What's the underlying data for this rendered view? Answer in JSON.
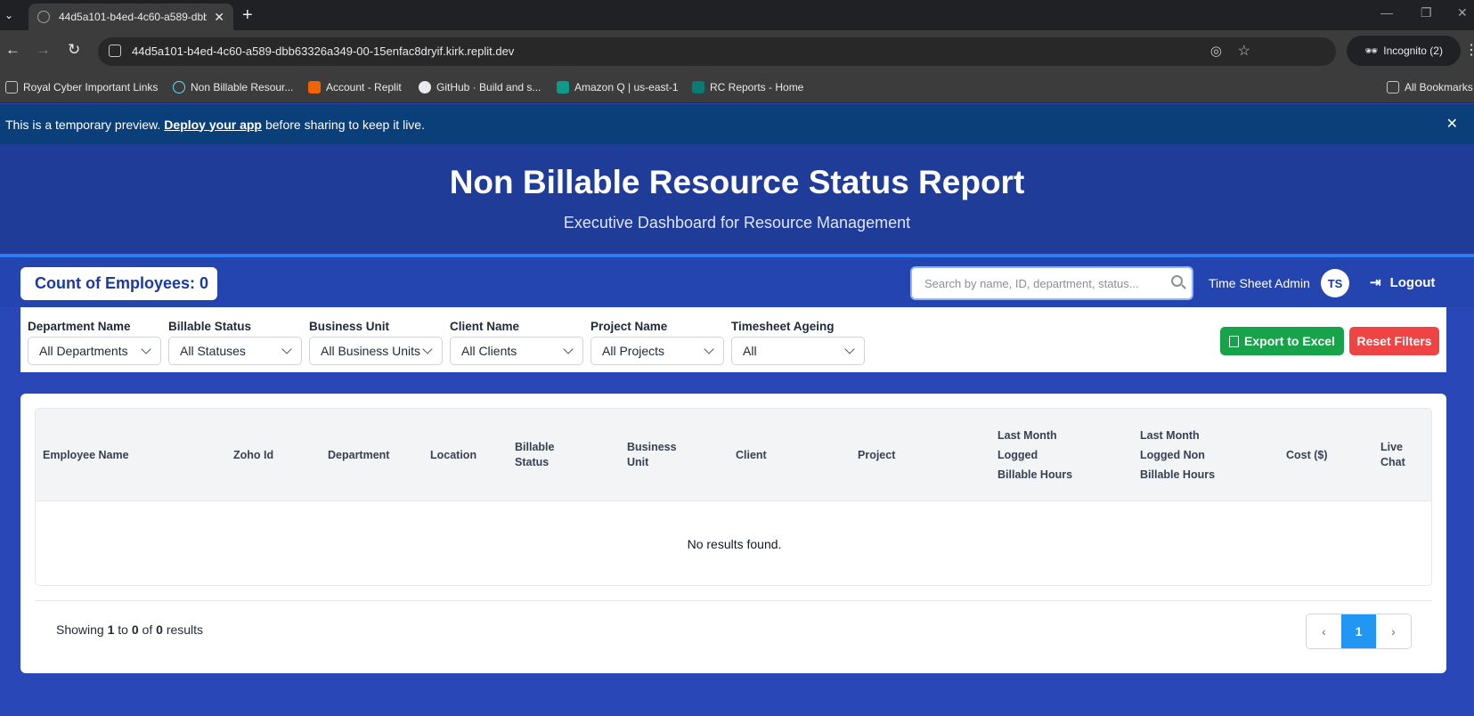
{
  "browser": {
    "tab_title": "44d5a101-b4ed-4c60-a589-dbb",
    "url": "44d5a101-b4ed-4c60-a589-dbb63326a349-00-15enfac8dryif.kirk.replit.dev",
    "incognito_label": "Incognito (2)",
    "bookmarks": [
      "Royal Cyber Important Links",
      "Non Billable Resour...",
      "Account - Replit",
      "GitHub · Build and s...",
      "Amazon Q | us-east-1",
      "RC Reports - Home"
    ],
    "all_bookmarks_label": "All Bookmarks"
  },
  "preview_banner": {
    "text_before": "This is a temporary preview.",
    "link_text": "Deploy your app",
    "text_after": "before sharing to keep it live."
  },
  "header": {
    "title": "Non Billable Resource Status Report",
    "subtitle": "Executive Dashboard for Resource Management"
  },
  "toolbar": {
    "count_label": "Count of Employees: 0",
    "search_placeholder": "Search by name, ID, department, status...",
    "user_name": "Time Sheet Admin",
    "avatar_initials": "TS",
    "logout_label": "Logout"
  },
  "filters": [
    {
      "label": "Department Name",
      "value": "All Departments"
    },
    {
      "label": "Billable Status",
      "value": "All Statuses"
    },
    {
      "label": "Business Unit",
      "value": "All Business Units"
    },
    {
      "label": "Client Name",
      "value": "All Clients"
    },
    {
      "label": "Project Name",
      "value": "All Projects"
    },
    {
      "label": "Timesheet Ageing",
      "value": "All"
    }
  ],
  "actions": {
    "export_label": "Export to Excel",
    "reset_label": "Reset Filters"
  },
  "table": {
    "columns": [
      [
        "Employee Name"
      ],
      [
        "Zoho Id"
      ],
      [
        "Department"
      ],
      [
        "Location"
      ],
      [
        "Billable",
        "Status"
      ],
      [
        "Business",
        "Unit"
      ],
      [
        "Client"
      ],
      [
        "Project"
      ],
      [
        "Last Month",
        "Logged",
        "Billable Hours"
      ],
      [
        "Last Month",
        "Logged Non",
        "Billable Hours"
      ],
      [
        "Cost ($)"
      ],
      [
        "Live",
        "Chat"
      ]
    ],
    "empty_message": "No results found."
  },
  "pagination": {
    "showing_prefix": "Showing",
    "from": "1",
    "to_word": "to",
    "to": "0",
    "of_word": "of",
    "total": "0",
    "results_word": "results",
    "current_page": "1",
    "prev_icon": "‹",
    "next_icon": "›"
  },
  "colors": {
    "header_bg": "#1f3c98",
    "accent": "#2d7cf2",
    "export": "#16a34a",
    "reset": "#ef4444",
    "active_page": "#2196f3"
  }
}
